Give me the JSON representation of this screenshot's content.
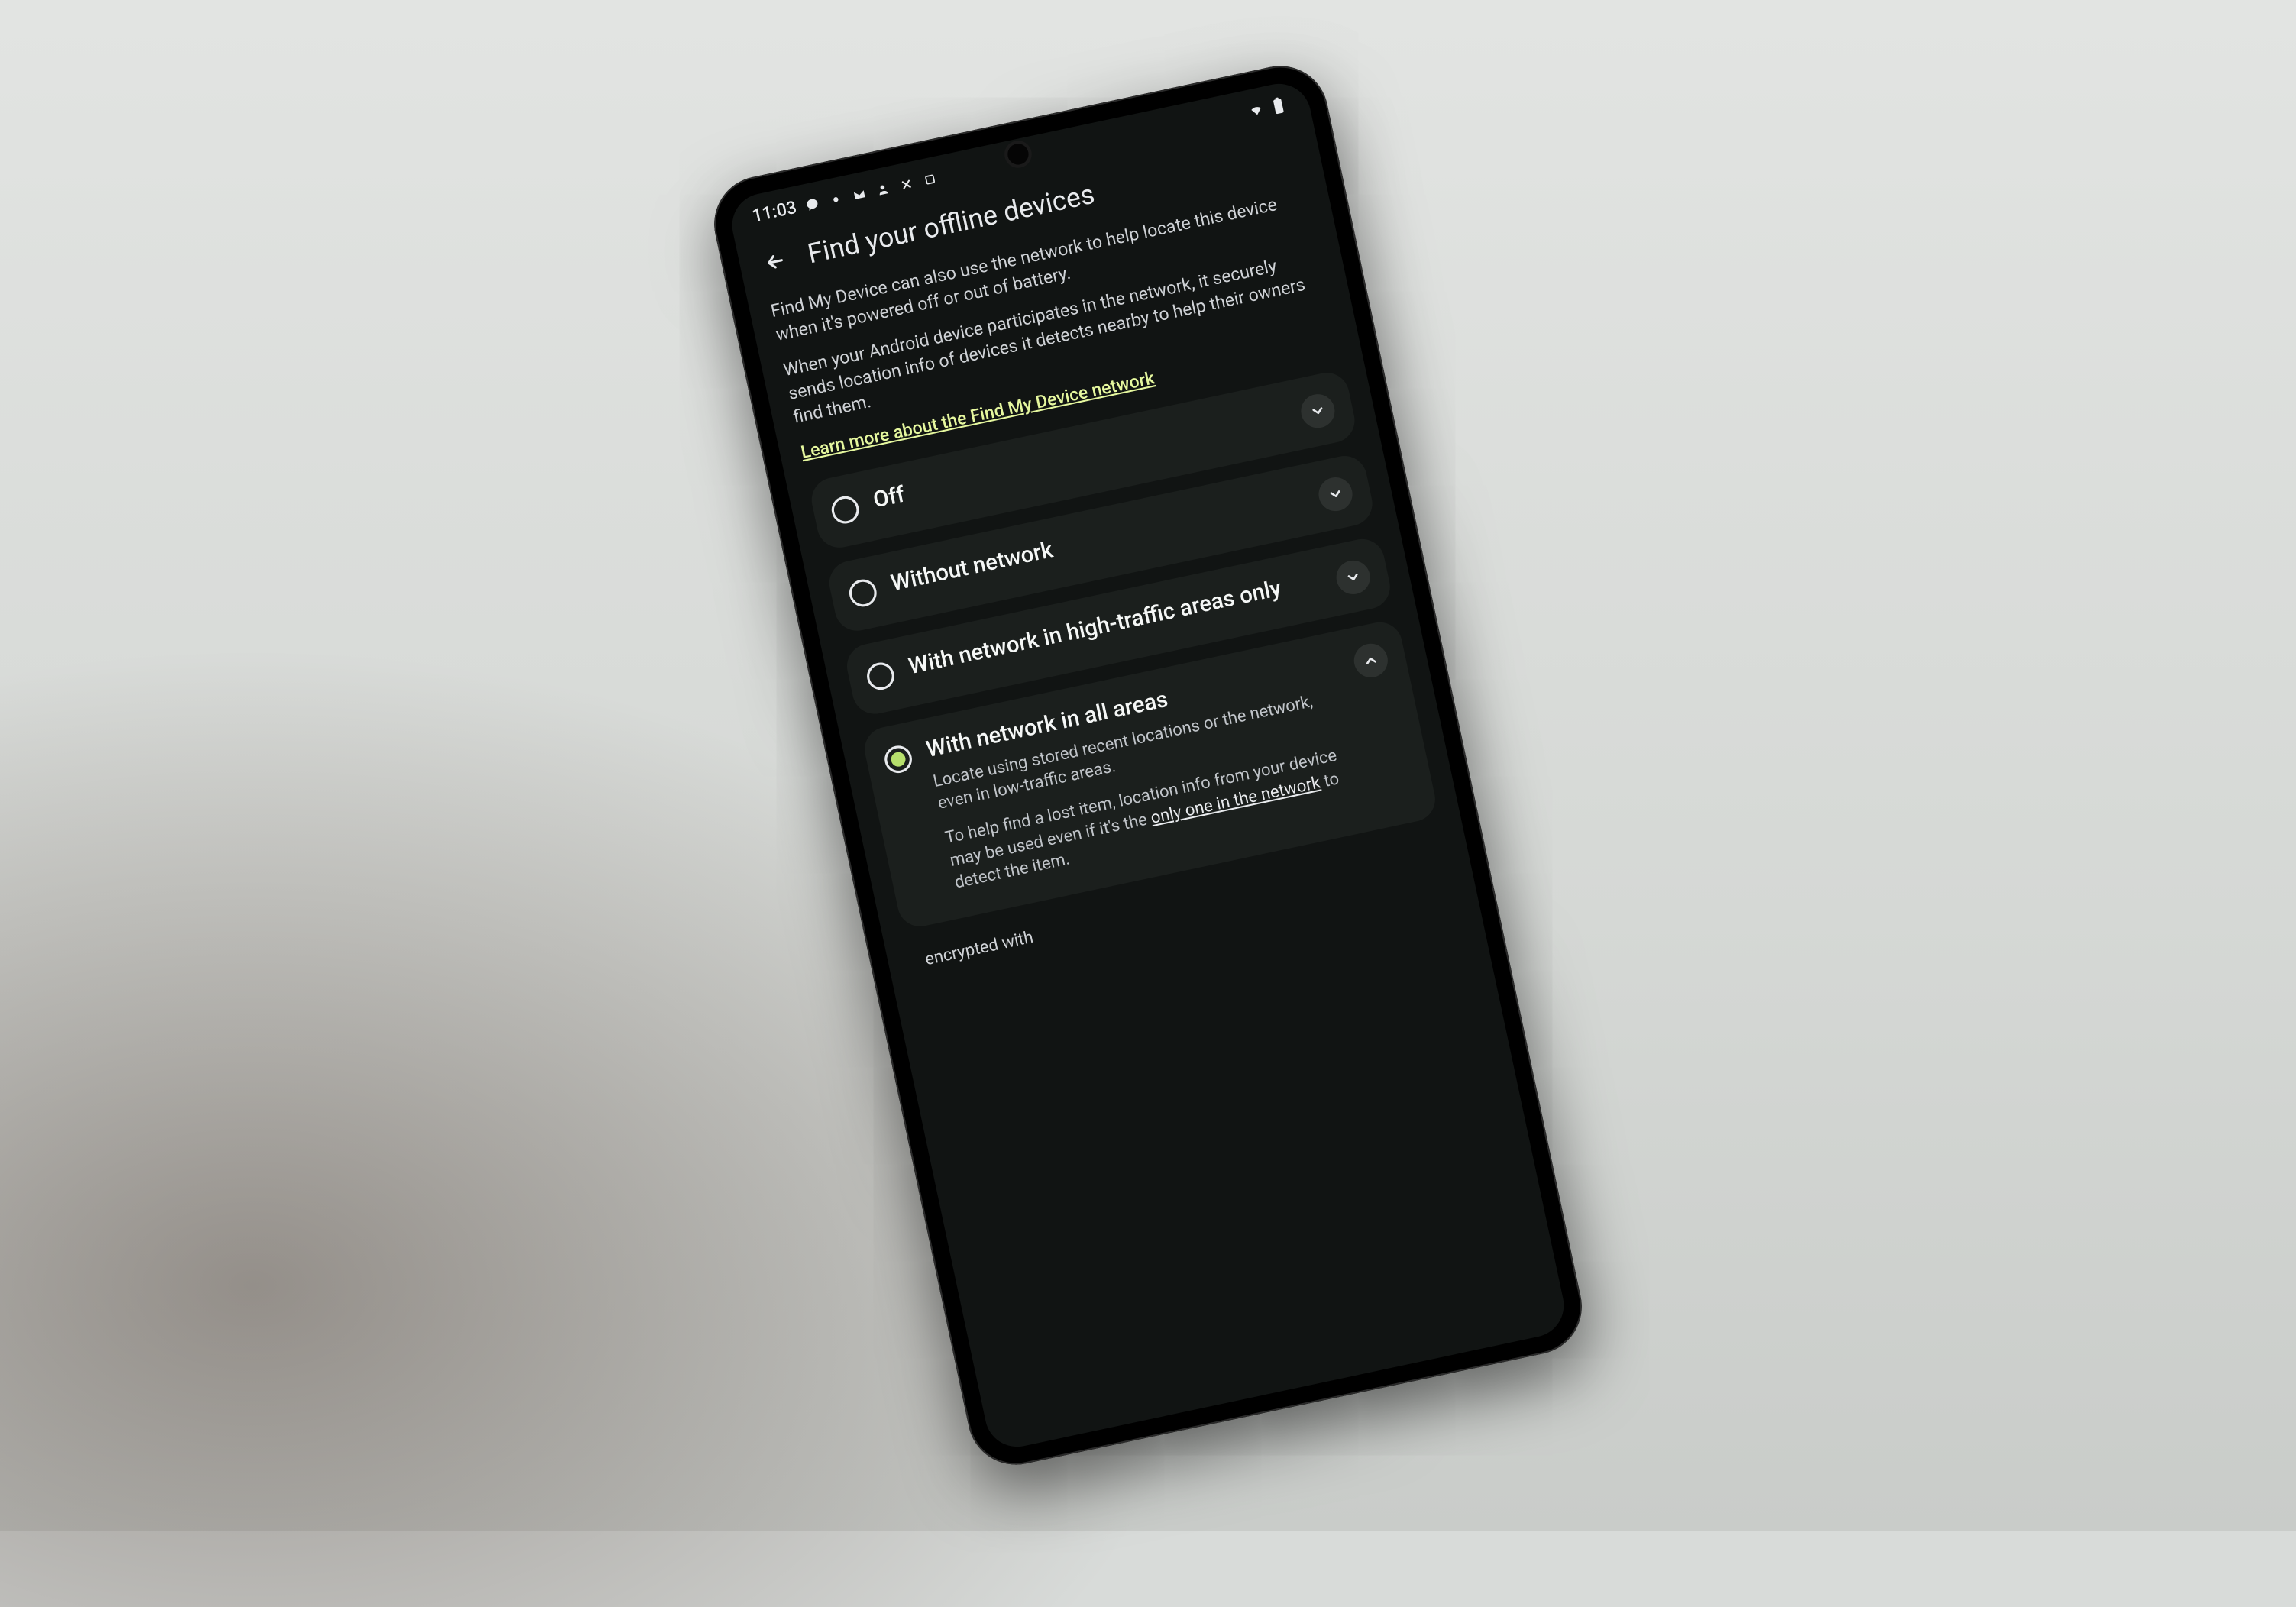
{
  "statusbar": {
    "time": "11:03",
    "icons_left": [
      "chat-icon",
      "new-icon",
      "mail-icon",
      "person-icon",
      "tools-icon",
      "square-icon"
    ],
    "icons_right": [
      "wifi-icon",
      "battery-icon"
    ]
  },
  "header": {
    "title": "Find your offline devices"
  },
  "intro": {
    "para1": "Find My Device can also use the network to help locate this device when it's powered off or out of battery.",
    "para2": "When your Android device participates in the network, it securely sends location info of devices it detects nearby to help their owners find them.",
    "learn_link": "Learn more about the Find My Device network"
  },
  "options": [
    {
      "id": "off",
      "label": "Off",
      "expanded": false,
      "selected": false
    },
    {
      "id": "without-network",
      "label": "Without network",
      "expanded": false,
      "selected": false
    },
    {
      "id": "high-traffic",
      "label": "With network in high-traffic areas only",
      "expanded": false,
      "selected": false
    },
    {
      "id": "all-areas",
      "label": "With network in all areas",
      "expanded": true,
      "selected": true,
      "subtitle": "Locate using stored recent locations or the network, even in low-traffic areas.",
      "extra_pre": "To help find a lost item, location info from your device may be used even if it's the ",
      "extra_link": "only one in the network",
      "extra_post": " to detect the item."
    }
  ],
  "footer": {
    "hint": "encrypted with"
  },
  "colors": {
    "accent_link": "#e5f79e",
    "radio_fill": "#b7e06d",
    "card_bg": "#1b1f1d",
    "screen_bg": "#111413"
  }
}
